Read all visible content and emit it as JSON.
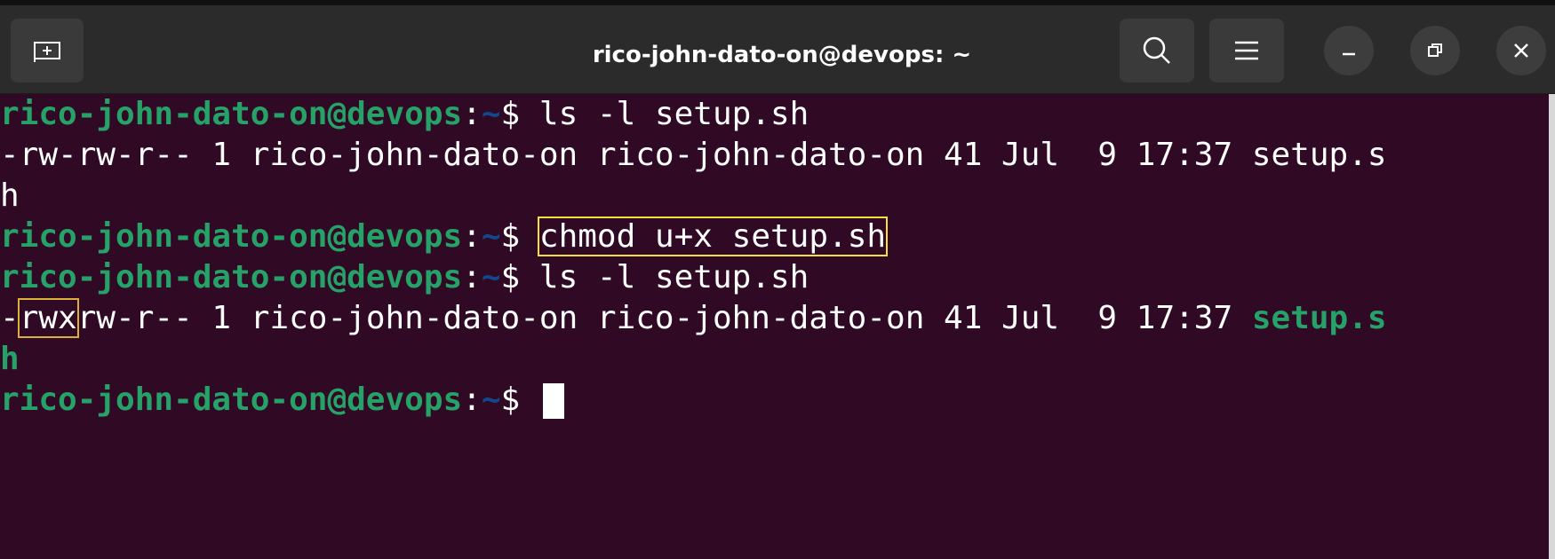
{
  "window": {
    "title": "rico-john-dato-on@devops: ~"
  },
  "titlebar": {
    "buttons": [
      "new-tab",
      "search",
      "menu",
      "minimize",
      "maximize",
      "close"
    ]
  },
  "terminal": {
    "prompt_user": "rico-john-dato-on@devops",
    "prompt_colon": ":",
    "prompt_path": "~",
    "prompt_symbol": "$ ",
    "lines": {
      "cmd1": "ls -l setup.sh",
      "out1a": "-rw-rw-r-- 1 rico-john-dato-on rico-john-dato-on 41 Jul  9 17:37 setup.s",
      "out1b": "h",
      "cmd2": "chmod u+x setup.sh",
      "cmd3": "ls -l setup.sh",
      "out2_prefix": "-",
      "out2_perm_user": "rwx",
      "out2_rest": "rw-r-- 1 rico-john-dato-on rico-john-dato-on 41 Jul  9 17:37 ",
      "out2_file_a": "setup.s",
      "out2_file_b": "h"
    }
  },
  "colors": {
    "terminal_bg": "#300a24",
    "prompt_green": "#26a269",
    "path_blue": "#12488b",
    "highlight_yellow": "#f5e13a"
  }
}
